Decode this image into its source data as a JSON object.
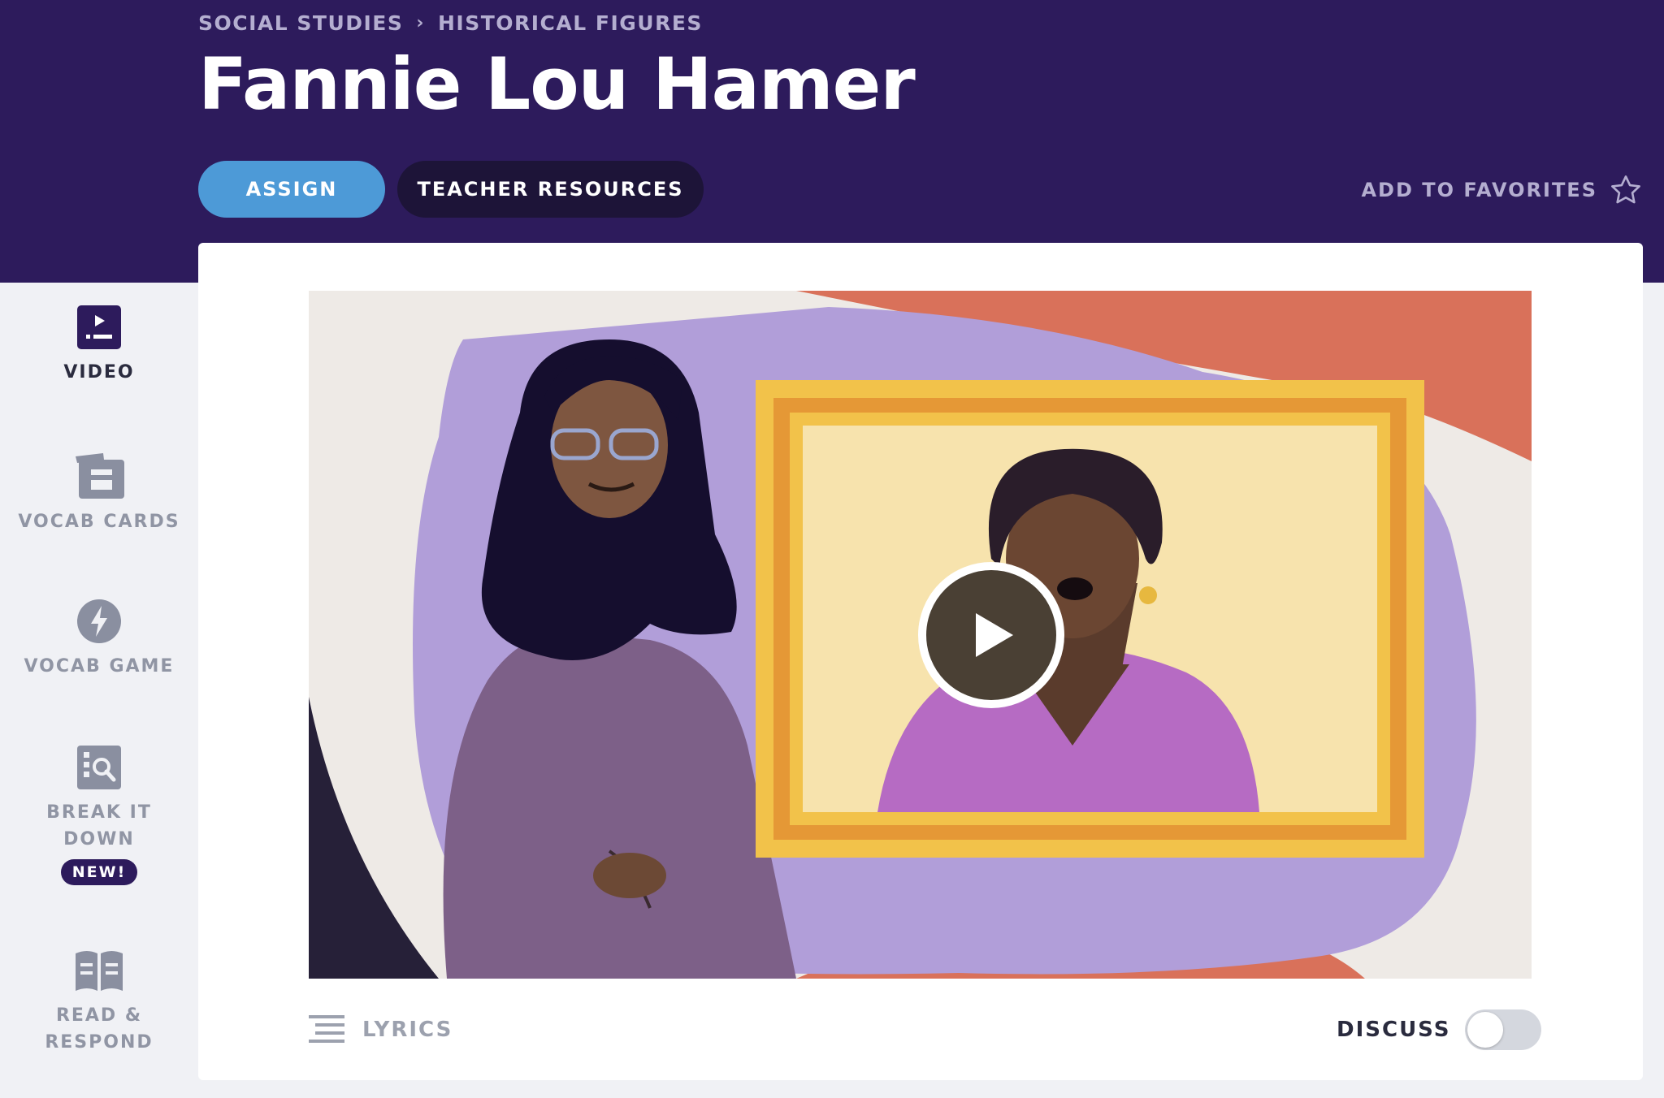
{
  "breadcrumb": {
    "items": [
      "SOCIAL STUDIES",
      "HISTORICAL FIGURES"
    ],
    "separator": "›"
  },
  "title": "Fannie Lou Hamer",
  "actions": {
    "assign": "ASSIGN",
    "teacher_resources": "TEACHER RESOURCES",
    "add_to_favorites": "ADD TO FAVORITES"
  },
  "sidebar": {
    "items": [
      {
        "label": "VIDEO",
        "icon": "video-icon",
        "active": true
      },
      {
        "label": "VOCAB CARDS",
        "icon": "vocab-cards-icon",
        "active": false
      },
      {
        "label": "VOCAB GAME",
        "icon": "lightning-icon",
        "active": false
      },
      {
        "label": "BREAK IT DOWN",
        "icon": "magnifier-icon",
        "active": false,
        "badge": "NEW!"
      },
      {
        "label": "READ & RESPOND",
        "icon": "open-book-icon",
        "active": false
      }
    ]
  },
  "player": {
    "play_icon": "play-icon",
    "lyrics": "LYRICS",
    "discuss": "DISCUSS",
    "discuss_enabled": false
  },
  "colors": {
    "header": "#2d1b5c",
    "assign_button": "#4d9ad7",
    "resources_button": "#1d1438",
    "badge": "#2d1b5c"
  }
}
